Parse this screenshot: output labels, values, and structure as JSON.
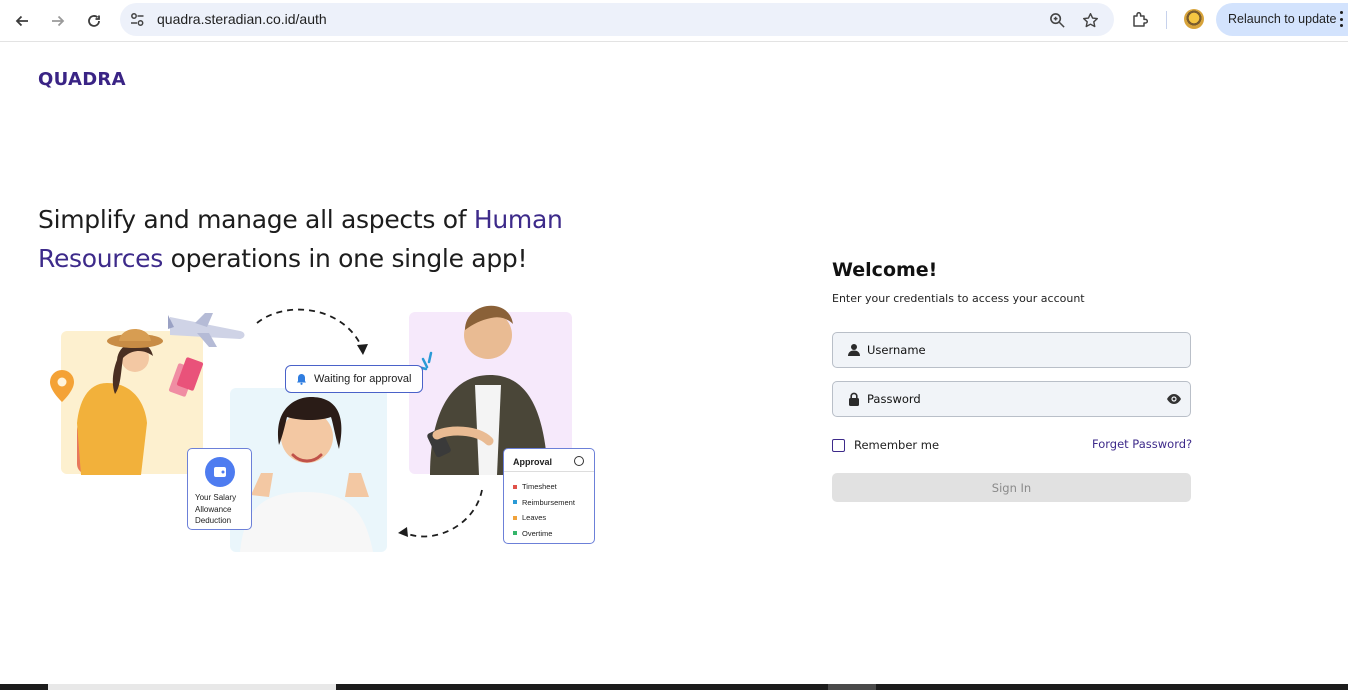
{
  "browser": {
    "url": "quadra.steradian.co.id/auth",
    "relaunch_label": "Relaunch to update",
    "icons": [
      "back-icon",
      "forward-icon",
      "reload-icon",
      "site-info-icon",
      "zoom-icon",
      "bookmark-star-icon",
      "extensions-icon",
      "profile-avatar",
      "more-menu-icon"
    ]
  },
  "brand": {
    "logo": "QUADRA",
    "primary_color": "#3d2a8a"
  },
  "hero": {
    "headline_part1": "Simplify and manage all aspects of ",
    "headline_highlight": "Human Resources",
    "headline_part2": " operations in one single app!",
    "waiting_badge": "Waiting for approval",
    "salary_card": "Your Salary Allowance Deduction",
    "approval_card": {
      "title": "Approval",
      "items": [
        {
          "label": "Timesheet",
          "color": "#e0524a"
        },
        {
          "label": "Reimbursement",
          "color": "#2a9ad6"
        },
        {
          "label": "Leaves",
          "color": "#f0a23a"
        },
        {
          "label": "Overtime",
          "color": "#35b56a"
        }
      ]
    }
  },
  "login": {
    "title": "Welcome!",
    "subtitle": "Enter your credentials to access your account",
    "username_placeholder": "Username",
    "password_placeholder": "Password",
    "remember_label": "Remember me",
    "forget_label": "Forget Password?",
    "signin_label": "Sign In"
  }
}
